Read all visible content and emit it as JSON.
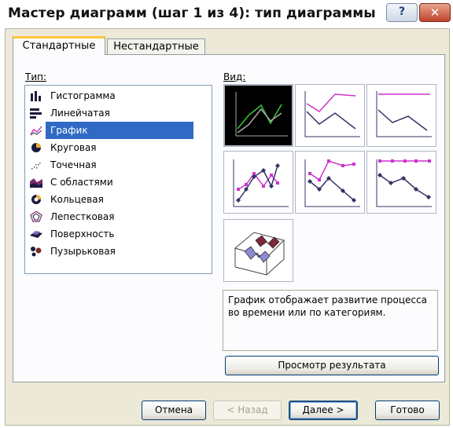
{
  "window": {
    "title": "Мастер диаграмм (шаг 1 из 4): тип диаграммы",
    "help_glyph": "?",
    "close_glyph": "✕"
  },
  "tabs": [
    {
      "label": "Стандартные",
      "active": true
    },
    {
      "label": "Нестандартные",
      "active": false
    }
  ],
  "type_list": {
    "label": "Тип:",
    "items": [
      {
        "label": "Гистограмма",
        "icon": "column-chart-icon"
      },
      {
        "label": "Линейчатая",
        "icon": "bar-chart-icon"
      },
      {
        "label": "График",
        "icon": "line-chart-icon",
        "selected": true
      },
      {
        "label": "Круговая",
        "icon": "pie-chart-icon"
      },
      {
        "label": "Точечная",
        "icon": "scatter-chart-icon"
      },
      {
        "label": "С областями",
        "icon": "area-chart-icon"
      },
      {
        "label": "Кольцевая",
        "icon": "doughnut-chart-icon"
      },
      {
        "label": "Лепестковая",
        "icon": "radar-chart-icon"
      },
      {
        "label": "Поверхность",
        "icon": "surface-chart-icon"
      },
      {
        "label": "Пузырьковая",
        "icon": "bubble-chart-icon"
      }
    ],
    "scroll_up_glyph": "▲",
    "scroll_down_glyph": "▼"
  },
  "subtype": {
    "label": "Вид:",
    "thumbnails": [
      {
        "name": "line-subtype-thumbnail",
        "selected": true
      },
      {
        "name": "stacked-line-subtype-thumbnail"
      },
      {
        "name": "100-stacked-line-subtype-thumbnail"
      },
      {
        "name": "line-markers-subtype-thumbnail"
      },
      {
        "name": "stacked-line-markers-subtype-thumbnail"
      },
      {
        "name": "100-stacked-line-markers-subtype-thumbnail"
      },
      {
        "name": "3d-line-subtype-thumbnail"
      }
    ],
    "description": "График отображает развитие процесса во времени или по категориям."
  },
  "preview_button": "Просмотр результата",
  "buttons": {
    "cancel": "Отмена",
    "back": "< Назад",
    "next": "Далее >",
    "finish": "Готово"
  },
  "colors": {
    "selection": "#316ac5",
    "series_primary": "#cc33cc",
    "series_secondary": "#333366",
    "selected_thumb_series_1": "#33cc33",
    "selected_thumb_series_2": "#888888"
  }
}
